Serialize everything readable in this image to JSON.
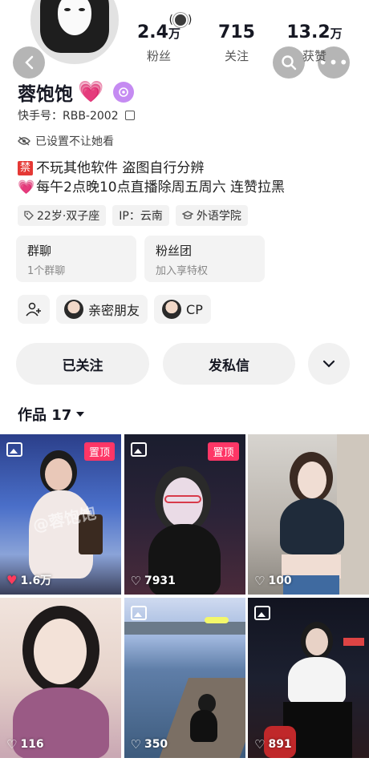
{
  "header": {
    "stats": [
      {
        "num": "2.4",
        "unit": "万",
        "label": "粉丝"
      },
      {
        "num": "715",
        "unit": "",
        "label": "关注"
      },
      {
        "num": "13.2",
        "unit": "万",
        "label": "获赞"
      }
    ],
    "more_glyph": "•••"
  },
  "profile": {
    "name": "蓉饱饱",
    "name_emoji": "💗",
    "id_label": "快手号：RBB-2002",
    "privacy_text": "已设置不让她看",
    "bio_tag": "禁",
    "bio_line1": "不玩其他软件 盗图自行分辨",
    "bio_line2_emoji": "💗",
    "bio_line2": "每午2点晚10点直播除周五周六  连赞拉黑",
    "chips": [
      "22岁·双子座",
      "IP：云南",
      "外语学院"
    ]
  },
  "cards": [
    {
      "title": "群聊",
      "sub": "1个群聊"
    },
    {
      "title": "粉丝团",
      "sub": "加入享特权"
    }
  ],
  "friends": [
    {
      "label": "亲密朋友"
    },
    {
      "label": "CP"
    }
  ],
  "actions": {
    "follow_label": "已关注",
    "message_label": "发私信"
  },
  "works": {
    "label": "作品 17"
  },
  "grid": [
    {
      "pinned": "置顶",
      "likes": "1.6万",
      "liked": true,
      "image": true,
      "watermark": "@蓉饱饱"
    },
    {
      "pinned": "置顶",
      "likes": "7931",
      "liked": false,
      "image": true
    },
    {
      "pinned": "",
      "likes": "100",
      "liked": false,
      "image": false
    },
    {
      "pinned": "",
      "likes": "116",
      "liked": false,
      "image": false
    },
    {
      "pinned": "",
      "likes": "350",
      "liked": false,
      "image": true
    },
    {
      "pinned": "",
      "likes": "891",
      "liked": false,
      "image": true
    }
  ]
}
